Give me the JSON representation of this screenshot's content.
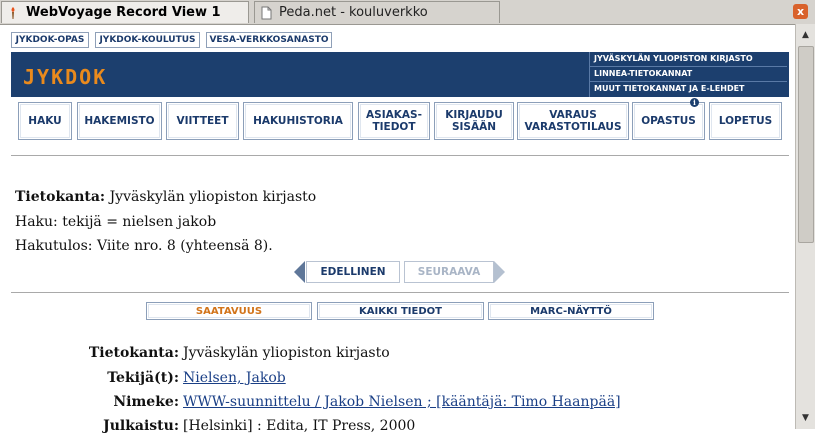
{
  "browser": {
    "tabs": [
      {
        "title": "WebVoyage Record View 1",
        "active": true
      },
      {
        "title": "Peda.net - kouluverkko",
        "active": false
      }
    ],
    "close_label": "x"
  },
  "top_links": [
    "JYKDOK-OPAS",
    "JYKDOK-KOULUTUS",
    "VESA-VERKKOSANASTO"
  ],
  "banner": {
    "logo": "JYKDOK",
    "links": [
      "JYVÄSKYLÄN YLIOPISTON KIRJASTO",
      "LINNEA-TIETOKANNAT",
      "MUUT TIETOKANNAT JA E-LEHDET"
    ]
  },
  "nav": [
    {
      "label": "HAKU"
    },
    {
      "label": "HAKEMISTO"
    },
    {
      "label": "VIITTEET"
    },
    {
      "label": "HAKUHISTORIA"
    },
    {
      "label": "ASIAKAS-\nTIEDOT"
    },
    {
      "label": "KIRJAUDU\nSISÄÄN"
    },
    {
      "label": "VARAUS\nVARASTOTILAUS"
    },
    {
      "label": "OPASTUS"
    },
    {
      "label": "LOPETUS"
    }
  ],
  "info_icon": "i",
  "search_info": {
    "database_label": "Tietokanta:",
    "database_value": "Jyväskylän yliopiston kirjasto",
    "query": "Haku: tekijä = nielsen jakob",
    "result": "Hakutulos: Viite nro. 8 (yhteensä 8)."
  },
  "pager": {
    "prev": "EDELLINEN",
    "next": "SEURAAVA"
  },
  "view_tabs": [
    "SAATAVUUS",
    "KAIKKI TIEDOT",
    "MARC-NÄYTTÖ"
  ],
  "record": [
    {
      "label": "Tietokanta:",
      "value": "Jyväskylän yliopiston kirjasto",
      "link": false
    },
    {
      "label": "Tekijä(t):",
      "value": "Nielsen, Jakob",
      "link": true
    },
    {
      "label": "Nimeke:",
      "value": "WWW-suunnittelu / Jakob Nielsen ; [kääntäjä: Timo Haanpää]",
      "link": true
    },
    {
      "label": "Julkaistu:",
      "value": "[Helsinki] : Edita, IT Press, 2000",
      "link": false
    }
  ],
  "colors": {
    "banner": "#1c3f6e",
    "logo": "#e98a1d",
    "active_view": "#d2741a",
    "link": "#1a3f86"
  }
}
